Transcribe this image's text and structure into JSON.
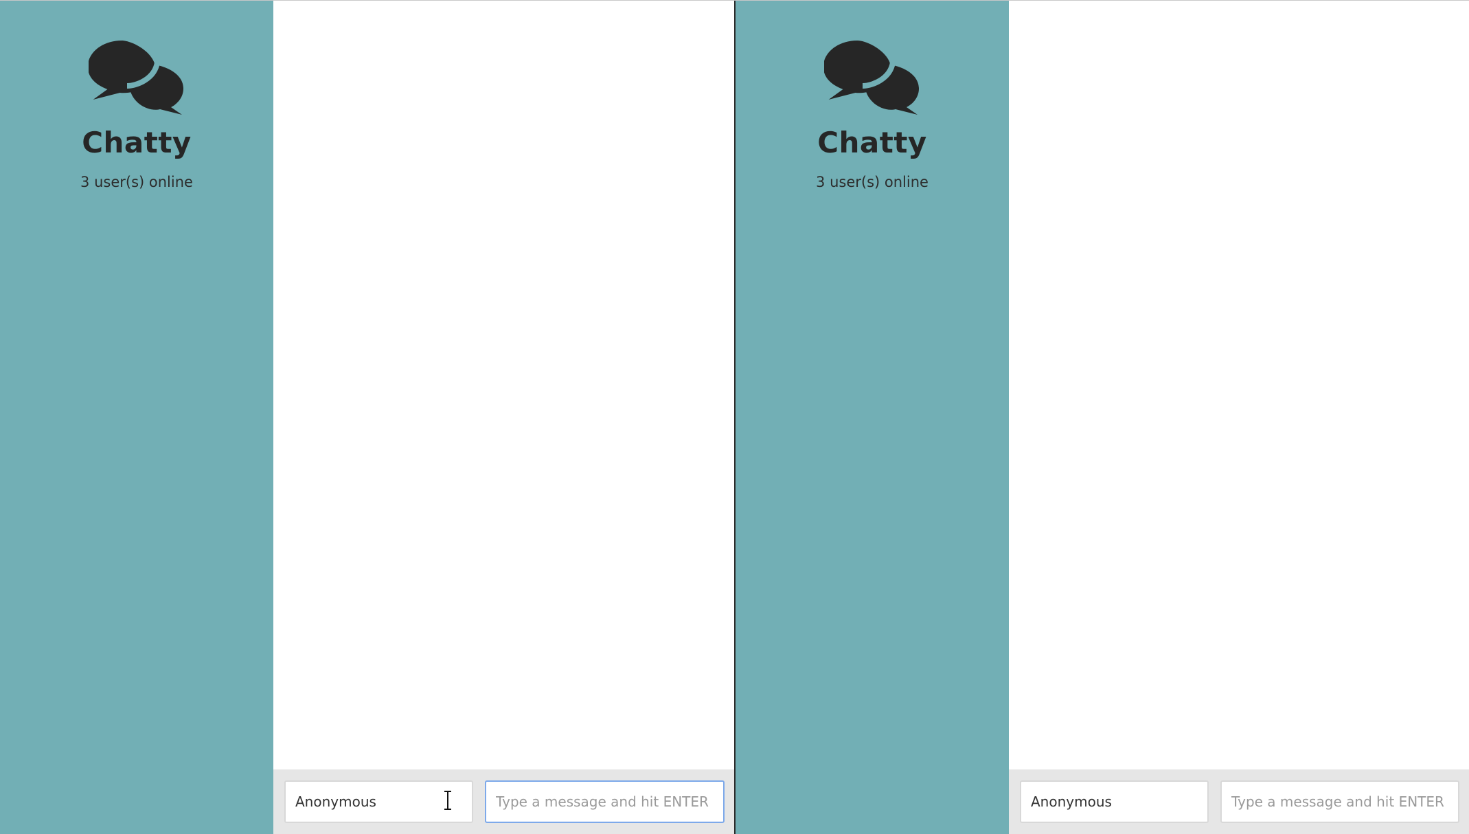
{
  "windows": [
    {
      "app_title": "Chatty",
      "online_count": "3 user(s) online",
      "logo_icon": "chat-bubbles-icon",
      "composer": {
        "username_value": "Anonymous",
        "message_placeholder": "Type a message and hit ENTER",
        "message_value": "",
        "message_focused": true
      }
    },
    {
      "app_title": "Chatty",
      "online_count": "3 user(s) online",
      "logo_icon": "chat-bubbles-icon",
      "composer": {
        "username_value": "Anonymous",
        "message_placeholder": "Type a message and hit ENTER",
        "message_value": "",
        "message_focused": false
      }
    }
  ],
  "colors": {
    "sidebar": "#72afb5",
    "composer_bar": "#e6e6e6",
    "focus_border": "#7da9ea",
    "text_dark": "#262626"
  },
  "mouse_cursor": "text-cursor-icon"
}
